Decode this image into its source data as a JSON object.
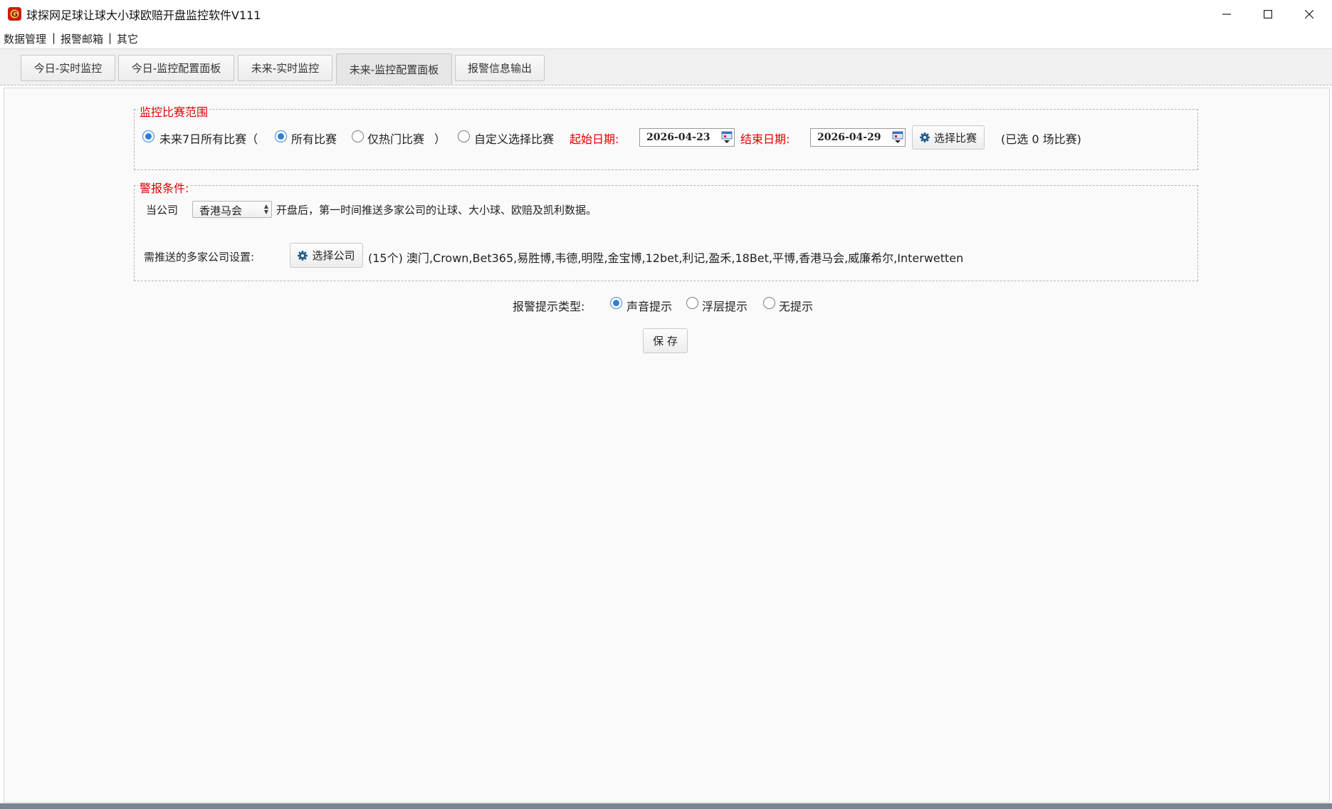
{
  "window": {
    "title": "球探网足球让球大小球欧赔开盘监控软件V111",
    "minimize_icon": "minimize-icon",
    "maximize_icon": "maximize-icon",
    "close_icon": "close-icon"
  },
  "menu": {
    "items": [
      "数据管理",
      "报警邮箱",
      "其它"
    ],
    "separator": "|"
  },
  "tabs": [
    {
      "label": "今日-实时监控",
      "active": false
    },
    {
      "label": "今日-监控配置面板",
      "active": false
    },
    {
      "label": "未来-实时监控",
      "active": false
    },
    {
      "label": "未来-监控配置面板",
      "active": true
    },
    {
      "label": "报警信息输出",
      "active": false
    }
  ],
  "range": {
    "legend": "监控比赛范围",
    "opt_all7": "未来7日所有比赛（",
    "opt_all": "所有比赛",
    "opt_hot": "仅热门比赛",
    "paren_close": "）",
    "opt_custom": "自定义选择比赛",
    "start_label": "起始日期:",
    "start_date": "2026-04-23",
    "end_label": "结束日期:",
    "end_date": "2026-04-29",
    "select_match_button": "选择比赛",
    "selected_info": "(已选  0  场比赛)",
    "selected": {
      "all7": true,
      "all": true,
      "hot": false,
      "custom": false
    }
  },
  "alarm": {
    "legend": "警报条件:",
    "when_company_label": "当公司",
    "company_value": "香港马会",
    "after_text": "开盘后，第一时间推送多家公司的让球、大小球、欧赔及凯利数据。",
    "multi_label": "需推送的多家公司设置:",
    "select_company_button": "选择公司",
    "companies_text": "(15个) 澳门,Crown,Bet365,易胜博,韦德,明陞,金宝博,12bet,利记,盈禾,18Bet,平博,香港马会,威廉希尔,Interwetten"
  },
  "alert_type": {
    "label": "报警提示类型:",
    "options": [
      "声音提示",
      "浮层提示",
      "无提示"
    ],
    "selected": "声音提示"
  },
  "save_button": "保 存",
  "colors": {
    "accent_red": "#e00000",
    "radio_blue": "#2f7fd6",
    "gear_blue": "#1f5c8c"
  }
}
